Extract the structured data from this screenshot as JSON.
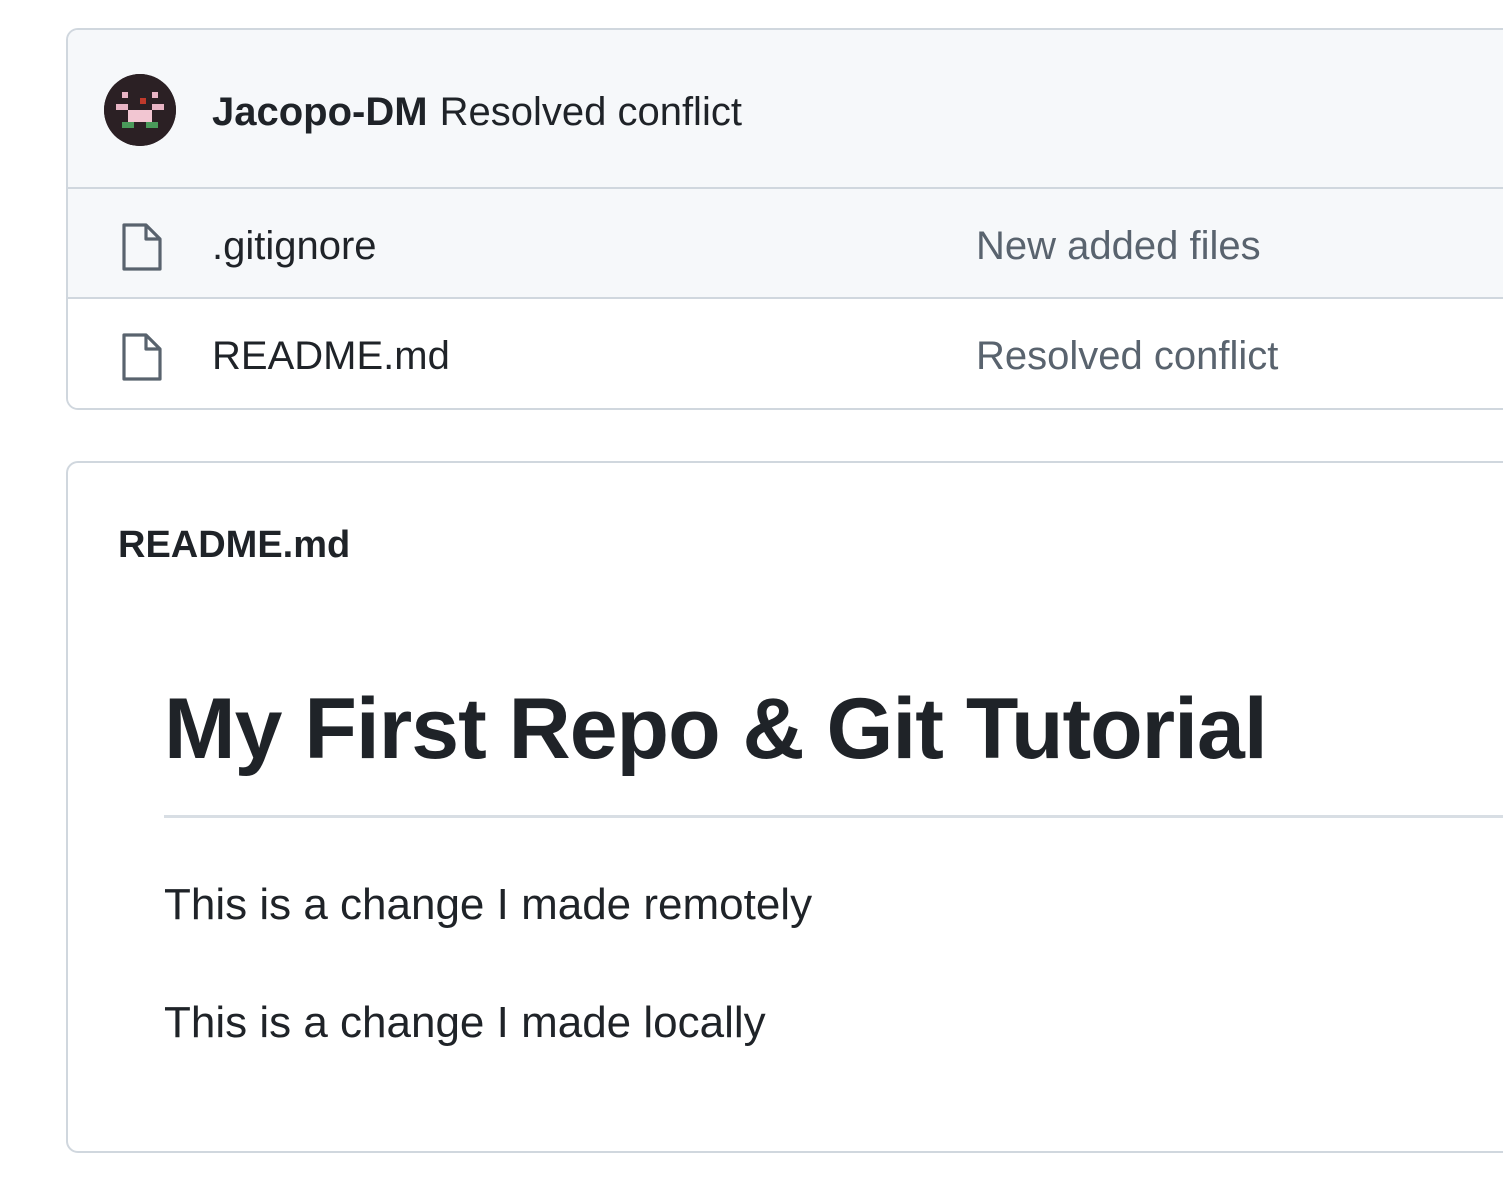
{
  "commit": {
    "author": "Jacopo-DM",
    "message": "Resolved conflict"
  },
  "files": [
    {
      "name": ".gitignore",
      "last_commit": "New added files",
      "icon": "file-icon"
    },
    {
      "name": "README.md",
      "last_commit": "Resolved conflict",
      "icon": "file-icon"
    }
  ],
  "readme": {
    "label": "README.md",
    "title": "My First Repo & Git Tutorial",
    "paragraphs": [
      "This is a change I made remotely",
      "This is a change I made locally"
    ]
  },
  "colors": {
    "border": "#d0d7de",
    "header_bg": "#f6f8fa",
    "text": "#1f2328",
    "muted": "#59636e"
  }
}
